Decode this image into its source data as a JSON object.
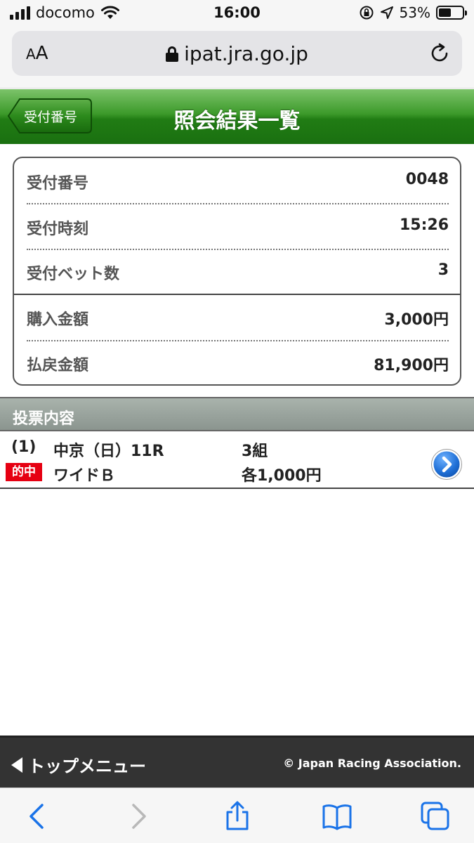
{
  "status_bar": {
    "carrier": "docomo",
    "time": "16:00",
    "battery_percent": "53%",
    "battery_level": 0.53
  },
  "browser": {
    "text_size_label": "AA",
    "url": "ipat.jra.go.jp"
  },
  "header": {
    "back_label": "受付番号",
    "title": "照会結果一覧"
  },
  "summary": {
    "rows": [
      {
        "label": "受付番号",
        "value": "0048"
      },
      {
        "label": "受付時刻",
        "value": "15:26"
      },
      {
        "label": "受付ベット数",
        "value": "3"
      },
      {
        "label": "購入金額",
        "value": "3,000円"
      },
      {
        "label": "払戻金額",
        "value": "81,900円"
      }
    ]
  },
  "vote_section": {
    "title": "投票内容",
    "ticket": {
      "number": "(1)",
      "race": "中京（日）11R",
      "combinations": "3組",
      "badge": "的中",
      "bet_type": "ワイドＢ",
      "amount": "各1,000円"
    }
  },
  "footer": {
    "top_menu_label": "トップメニュー",
    "copyright": "© Japan Racing Association."
  },
  "colors": {
    "header_green": "#217c14",
    "hit_badge_red": "#e60012",
    "chevron_blue": "#1f6fd6"
  }
}
